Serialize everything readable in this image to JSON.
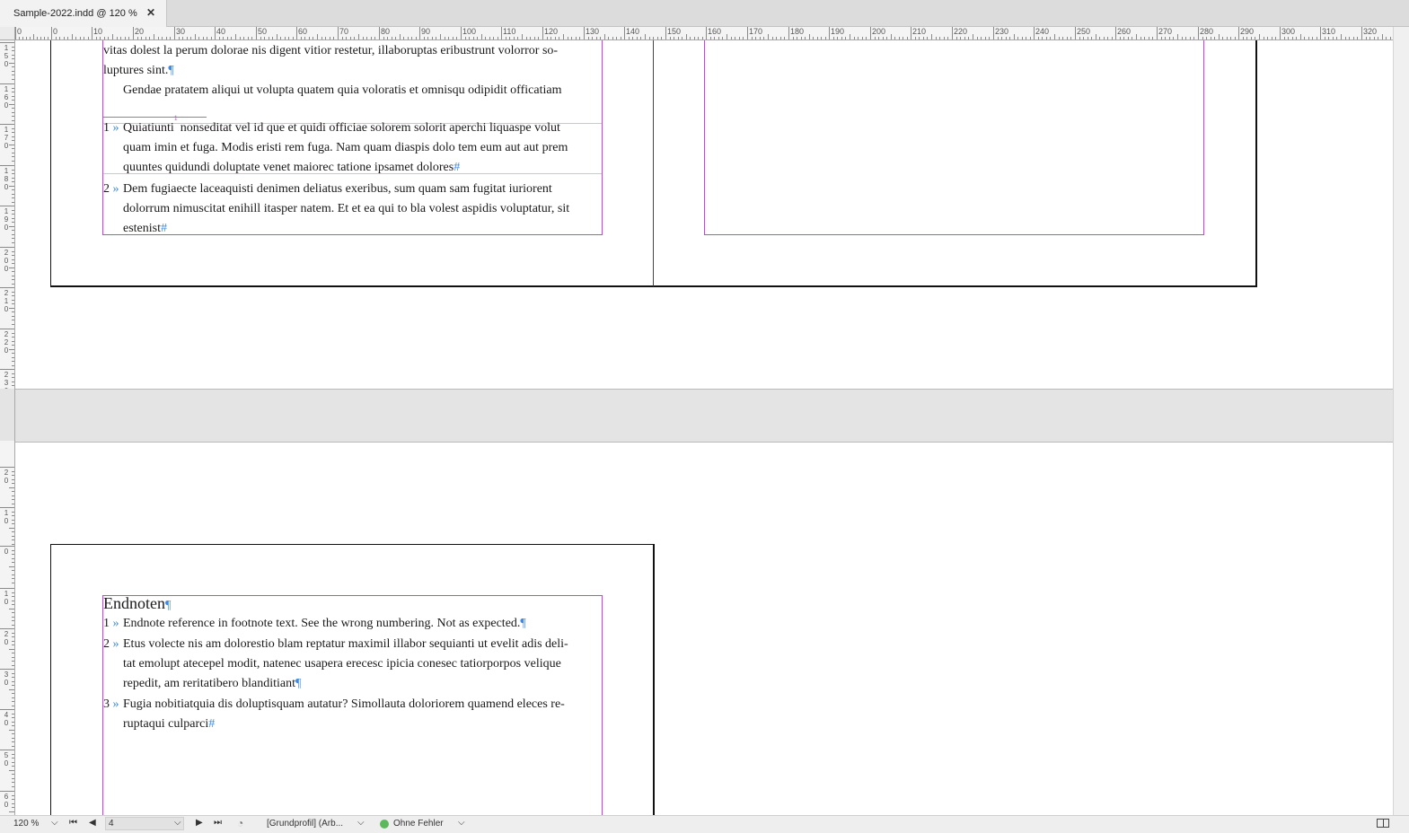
{
  "tab": {
    "title": "Sample-2022.indd @ 120 %",
    "close": "✕"
  },
  "ruler_h": [
    "0",
    "0",
    "10",
    "20",
    "30",
    "40",
    "50",
    "60",
    "70",
    "80",
    "90",
    "100",
    "110",
    "120",
    "130",
    "140",
    "150",
    "160",
    "170",
    "180",
    "190",
    "200",
    "210",
    "220",
    "230",
    "240",
    "250",
    "260",
    "270",
    "280",
    "290",
    "300",
    "310",
    "320"
  ],
  "ruler_v": [
    "1 5 0",
    "1 6 0",
    "1 7 0",
    "1 8 0",
    "1 9 0",
    "2 0 0",
    "2 1 0",
    "2 2 0",
    "2 3 0",
    "2 0",
    "1 0",
    "0",
    "1 0",
    "2 0",
    "3 0",
    "4 0",
    "5 0",
    "6 0"
  ],
  "top_text": {
    "line1": "vitas dolest la perum dolorae nis digent vitior restetur, illaboruptas eribustrunt volorror so-",
    "line2": "luptures sint.",
    "line3": "Gendae pratatem aliqui ut volupta quatem quia voloratis et omnisqu odipidit officatiam",
    "fn1_num": "1",
    "fn1_sep": "»",
    "fn1_l1a": "Quiatiunti",
    "fn1_sup": "1",
    "fn1_l1b": "nonseditat vel id que et quidi officiae solorem solorit aperchi liquaspe volut",
    "fn1_l2": "quam imin et fuga. Modis eristi rem fuga. Nam quam diaspis dolo tem eum aut aut prem",
    "fn1_l3": "quuntes quidundi doluptate venet maiorec tatione ipsamet dolores",
    "fn2_num": "2",
    "fn2_sep": "»",
    "fn2_l1": "Dem fugiaecte laceaquisti denimen deliatus exeribus, sum quam sam fugitat iuriorent",
    "fn2_l2": "dolorrum nimuscitat enihill itasper natem. Et et ea qui to bla volest aspidis voluptatur, sit",
    "fn2_l3": "estenist",
    "pilcrow": "¶",
    "hash": "#"
  },
  "endnotes": {
    "heading": "Endnoten",
    "e1_num": "1",
    "e1_l1": "Endnote reference in footnote text. See the wrong numbering. Not as expected.",
    "e2_num": "2",
    "e2_l1": "Etus volecte nis am dolorestio blam reptatur maximil illabor sequianti ut evelit adis deli-",
    "e2_l2": "tat emolupt atecepel modit, natenec usapera erecesc ipicia conesec tatiorporpos velique",
    "e2_l3": "repedit, am reritatibero blanditiant",
    "e3_num": "3",
    "e3_l1": "Fugia nobitiatquia dis doluptisquam autatur? Simollauta doloriorem quamend eleces re-",
    "e3_l2": "ruptaqui culparci",
    "sep": "»",
    "pilcrow": "¶",
    "hash": "#"
  },
  "status": {
    "zoom": "120 %",
    "page": "4",
    "profile": "[Grundprofil] (Arb...",
    "preflight": "Ohne Fehler",
    "colors": {
      "preflight_ok": "#5cb85c",
      "frame": "#d23cf0",
      "hidden_char": "#3c8ae6"
    }
  }
}
